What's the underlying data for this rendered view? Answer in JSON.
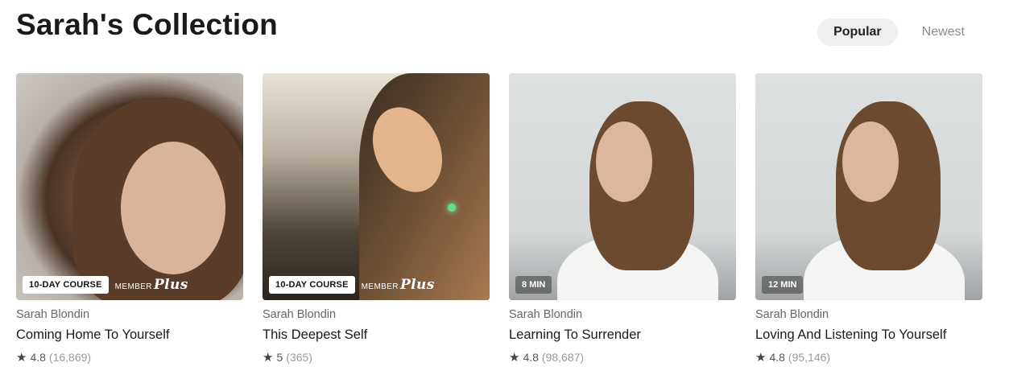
{
  "page": {
    "title": "Sarah's Collection"
  },
  "sort": {
    "popular_label": "Popular",
    "newest_label": "Newest",
    "selected": "Popular"
  },
  "cards": [
    {
      "teacher": "Sarah Blondin",
      "title": "Coming Home To Yourself",
      "badge": "10-DAY COURSE",
      "member_label": "MEMBER",
      "member_plus": "Plus",
      "rating": "4.8",
      "count": "(16,869)"
    },
    {
      "teacher": "Sarah Blondin",
      "title": "This Deepest Self",
      "badge": "10-DAY COURSE",
      "member_label": "MEMBER",
      "member_plus": "Plus",
      "rating": "5",
      "count": "(365)"
    },
    {
      "teacher": "Sarah Blondin",
      "title": "Learning To Surrender",
      "badge": "8 MIN",
      "rating": "4.8",
      "count": "(98,687)"
    },
    {
      "teacher": "Sarah Blondin",
      "title": "Loving And Listening To Yourself",
      "badge": "12 MIN",
      "rating": "4.8",
      "count": "(95,146)"
    }
  ],
  "icons": {
    "rating": "star-icon"
  }
}
